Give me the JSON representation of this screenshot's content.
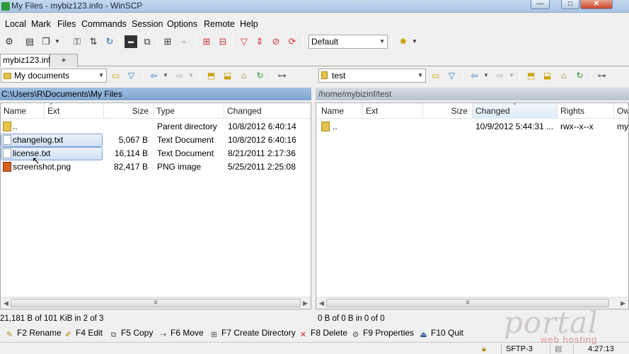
{
  "window": {
    "title": "My Files - mybiz123.info - WinSCP",
    "min": "—",
    "max": "□",
    "close": "✕"
  },
  "menu": [
    "Local",
    "Mark",
    "Files",
    "Commands",
    "Session",
    "Options",
    "Remote",
    "Help"
  ],
  "toolbar": {
    "transfer_profile": "Default"
  },
  "tabs": {
    "active": "mybiz123.info",
    "new": "+"
  },
  "left": {
    "location": "My documents",
    "path": "C:\\Users\\R\\Documents\\My Files",
    "columns": [
      "Name",
      "Ext",
      "Size",
      "Type",
      "Changed"
    ],
    "rows": [
      {
        "name": "..",
        "size": "",
        "type": "Parent directory",
        "changed": "10/8/2012  6:40:14",
        "icon": "folder-up-icon"
      },
      {
        "name": "changelog.txt",
        "size": "5,067 B",
        "type": "Text Document",
        "changed": "10/8/2012  6:40:16",
        "icon": "text-file-icon"
      },
      {
        "name": "license.txt",
        "size": "16,114 B",
        "type": "Text Document",
        "changed": "8/21/2011  2:17:36",
        "icon": "text-file-icon"
      },
      {
        "name": "screenshot.png",
        "size": "82,417 B",
        "type": "PNG image",
        "changed": "5/25/2011  2:25:08",
        "icon": "image-file-icon"
      }
    ],
    "status": "21,181 B of 101 KiB in 2 of 3"
  },
  "right": {
    "location": "test",
    "path": "/home/mybizinf/test",
    "columns": [
      "Name",
      "Ext",
      "Size",
      "Changed",
      "Rights",
      "Ow"
    ],
    "rows": [
      {
        "name": "..",
        "changed": "10/9/2012  5:44:31 ...",
        "rights": "rwx--x--x",
        "owner": "my",
        "icon": "folder-up-icon"
      }
    ],
    "status": "0 B of 0 B in 0 of 0"
  },
  "fkeys": [
    {
      "label": "F2 Rename",
      "icon": "rename-icon"
    },
    {
      "label": "F4 Edit",
      "icon": "edit-icon"
    },
    {
      "label": "F5 Copy",
      "icon": "copy-icon"
    },
    {
      "label": "F6 Move",
      "icon": "move-icon"
    },
    {
      "label": "F7 Create Directory",
      "icon": "create-directory-icon"
    },
    {
      "label": "F8 Delete",
      "icon": "delete-icon"
    },
    {
      "label": "F9 Properties",
      "icon": "properties-icon"
    },
    {
      "label": "F10 Quit",
      "icon": "quit-icon"
    }
  ],
  "statusbar": {
    "protocol": "SFTP-3",
    "time": "4:27:13"
  },
  "watermark": {
    "brand": "portal",
    "tagline": "web hosting"
  }
}
